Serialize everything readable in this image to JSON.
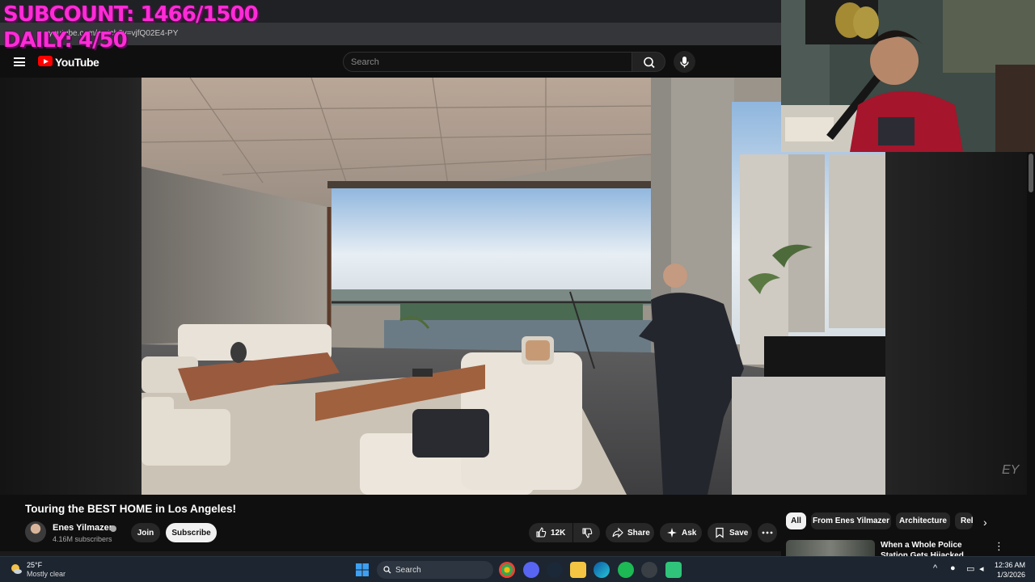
{
  "overlay": {
    "subcount": "SUBCOUNT: 1466/1500",
    "daily": "DAILY: 4/50"
  },
  "browser": {
    "url": "youtube.com/watch?v=vjfQ02E4-PY"
  },
  "header": {
    "logo_text": "YouTube",
    "search_placeholder": "Search"
  },
  "video": {
    "title": "Touring the BEST HOME in Los Angeles!",
    "watermark": "EY"
  },
  "channel": {
    "name": "Enes Yilmazer",
    "subscribers": "4.16M subscribers",
    "join_label": "Join",
    "subscribe_label": "Subscribe"
  },
  "actions": {
    "like_count": "12K",
    "share_label": "Share",
    "ask_label": "Ask",
    "save_label": "Save"
  },
  "chips": [
    {
      "label": "All"
    },
    {
      "label": "From Enes Yilmazer"
    },
    {
      "label": "Architecture"
    },
    {
      "label": "Rel"
    }
  ],
  "recommendation": {
    "title": "When a Whole Police Station Gets Hijacked"
  },
  "taskbar": {
    "weather_temp": "25°F",
    "weather_desc": "Mostly clear",
    "search_label": "Search",
    "time": "12:36 AM",
    "date": "1/3/2026"
  },
  "colors": {
    "overlay": "#ff2bd6",
    "yt_red": "#ff0000",
    "background": "#0f0f0f"
  }
}
